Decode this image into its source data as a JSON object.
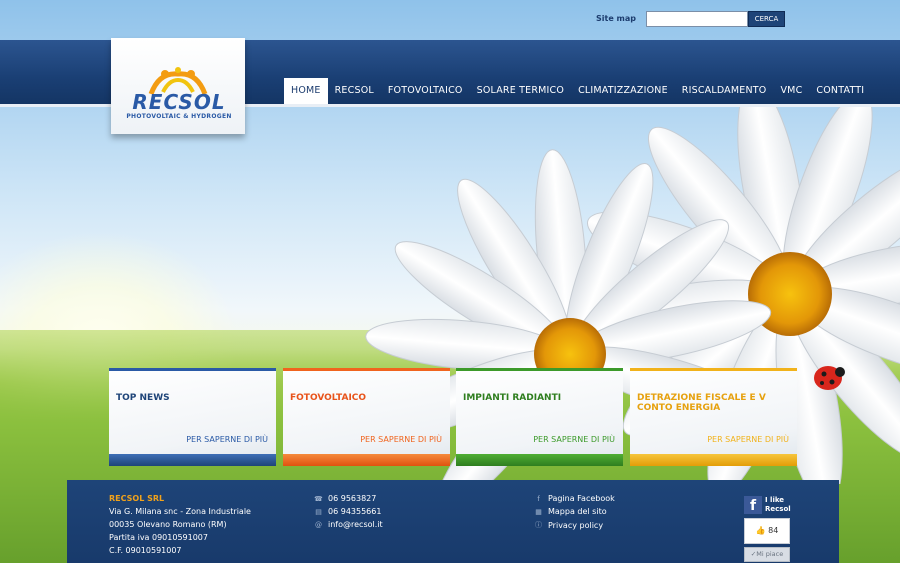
{
  "topbar": {
    "sitemap_label": "Site map",
    "search_placeholder": "",
    "search_button": "CERCA"
  },
  "logo": {
    "name": "RECSOL",
    "tagline": "PHOTOVOLTAIC & HYDROGEN"
  },
  "nav": {
    "items": [
      {
        "label": "HOME",
        "active": true
      },
      {
        "label": "RECSOL"
      },
      {
        "label": "FOTOVOLTAICO"
      },
      {
        "label": "SOLARE TERMICO"
      },
      {
        "label": "CLIMATIZZAZIONE"
      },
      {
        "label": "RISCALDAMENTO"
      },
      {
        "label": "VMC"
      },
      {
        "label": "CONTATTI"
      }
    ]
  },
  "cards": [
    {
      "title": "TOP NEWS",
      "more": "PER SAPERNE DI PIÙ",
      "color": "#2a5aa6"
    },
    {
      "title": "FOTOVOLTAICO",
      "more": "PER SAPERNE DI PIÙ",
      "color": "#f0641e"
    },
    {
      "title": "IMPIANTI RADIANTI",
      "more": "PER SAPERNE DI PIÙ",
      "color": "#3c9a2a"
    },
    {
      "title_line1": "DETRAZIONE FISCALE E V",
      "title_line2": "CONTO ENERGIA",
      "more": "PER SAPERNE DI PIÙ",
      "color": "#f1b21b"
    }
  ],
  "footer": {
    "company": "RECSOL SRL",
    "address_lines": [
      "Via G. Milana snc - Zona Industriale",
      "00035 Olevano Romano (RM)",
      "Partita iva 09010591007",
      "C.F. 09010591007"
    ],
    "contacts": [
      {
        "icon": "phone-icon",
        "text": "06 9563827"
      },
      {
        "icon": "fax-icon",
        "text": "06 94355661"
      },
      {
        "icon": "email-icon",
        "text": "info@recsol.it"
      }
    ],
    "links": [
      {
        "icon": "facebook-icon",
        "text": "Pagina Facebook"
      },
      {
        "icon": "sitemap-icon",
        "text": "Mappa del sito"
      },
      {
        "icon": "info-icon",
        "text": "Privacy policy"
      }
    ],
    "facebook": {
      "line1": "I like",
      "line2": "Recsol",
      "count": "84",
      "button": "Mi piace"
    }
  },
  "colors": {
    "brand_blue": "#1e4478",
    "accent_orange": "#f1a21b"
  }
}
